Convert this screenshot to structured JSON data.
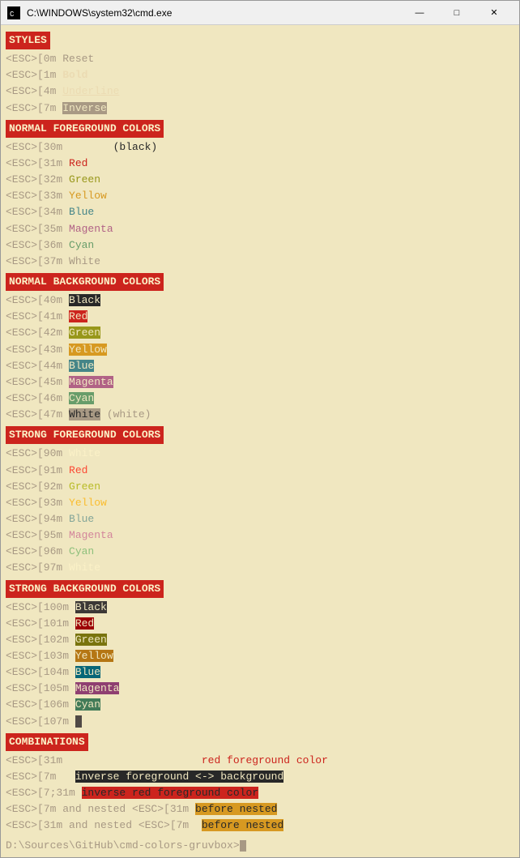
{
  "window": {
    "title": "C:\\WINDOWS\\system32\\cmd.exe",
    "min_label": "—",
    "max_label": "□",
    "close_label": "✕"
  },
  "sections": {
    "styles": "STYLES",
    "normal_fg": "NORMAL FOREGROUND COLORS",
    "normal_bg": "NORMAL BACKGROUND COLORS",
    "strong_fg": "STRONG FOREGROUND COLORS",
    "strong_bg": "STRONG BACKGROUND COLORS",
    "combinations": "COMBINATIONS"
  },
  "prompt": "D:\\Sources\\GitHub\\cmd-colors-gruvbox>"
}
